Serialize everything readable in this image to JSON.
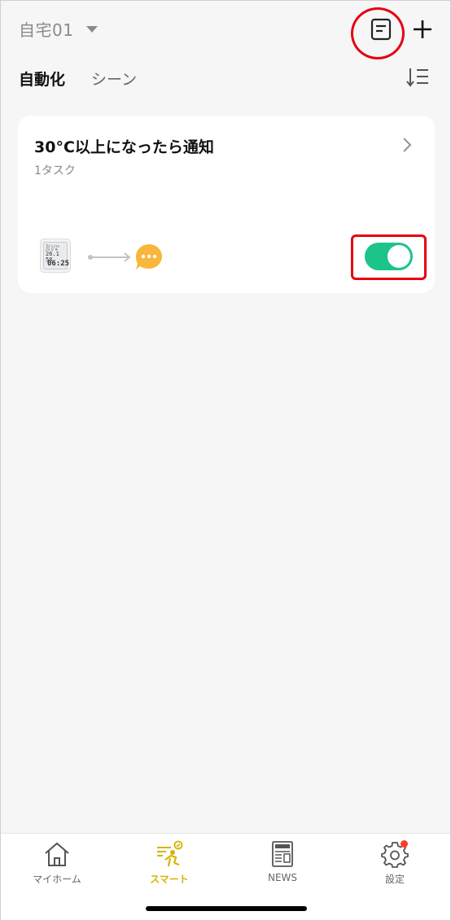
{
  "header": {
    "home_name": "自宅01",
    "log_icon": "document-log-icon",
    "add_icon": "plus-icon"
  },
  "tabs": [
    {
      "label": "自動化",
      "active": true
    },
    {
      "label": "シーン",
      "active": false
    }
  ],
  "sort_icon": "sort-list-icon",
  "automations": [
    {
      "title": "30°C以上になったら通知",
      "subtitle": "1タスク",
      "condition_device": "thermo-hygrometer-icon",
      "device_display": {
        "top": "TH-Lite 29.0 ♥",
        "middle": "26.1 58",
        "time": "06:25"
      },
      "action_icon": "notification-bubble-icon",
      "enabled": true
    }
  ],
  "bottom_nav": [
    {
      "label": "マイホーム",
      "icon": "home-icon",
      "active": false
    },
    {
      "label": "スマート",
      "icon": "smart-scene-icon",
      "active": true
    },
    {
      "label": "NEWS",
      "icon": "newspaper-icon",
      "active": false
    },
    {
      "label": "設定",
      "icon": "gear-icon",
      "active": false,
      "badge": true
    }
  ],
  "colors": {
    "accent_green": "#1bc58a",
    "active_tab_gold": "#d7b400",
    "highlight_red": "#e60012",
    "notify_orange": "#f8b63a"
  }
}
